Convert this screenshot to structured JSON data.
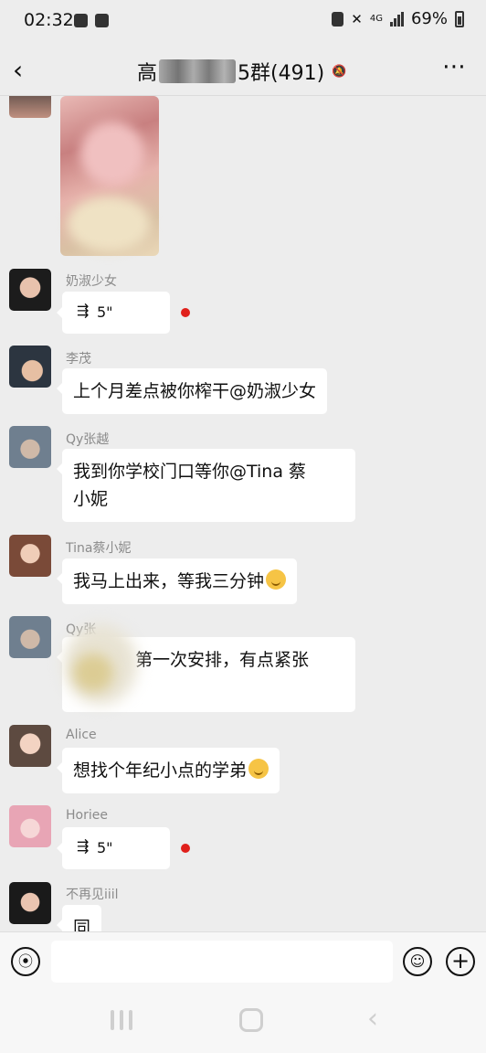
{
  "status_bar": {
    "time": "02:32",
    "network": "4G",
    "battery": "69%"
  },
  "header": {
    "back_icon": "chevron-left-icon",
    "title_start": "高",
    "title_end": "5群(491)",
    "mute_icon": "bell-slash-icon",
    "more_icon": "more-dots-icon"
  },
  "messages": [
    {
      "type": "image",
      "sender": ""
    },
    {
      "type": "voice",
      "sender": "奶淑少女",
      "duration": "5\"",
      "unread": true
    },
    {
      "type": "text",
      "sender": "李茂",
      "text": "上个月差点被你榨干@奶淑少女"
    },
    {
      "type": "text",
      "sender": "Qy张越",
      "line1": "我到你学校门口等你@Tina 蔡",
      "line2": "小妮"
    },
    {
      "type": "text",
      "sender": "Tina蔡小妮",
      "text": "我马上出来，等我三分钟",
      "emoji": "grin-emoji"
    },
    {
      "type": "text",
      "sender": "Qy张",
      "text": "第一次安排，有点紧张"
    },
    {
      "type": "text",
      "sender": "Alice",
      "text": "想找个年纪小点的学弟",
      "emoji": "smile-emoji"
    },
    {
      "type": "voice",
      "sender": "Horiee",
      "duration": "5\"",
      "unread": true
    },
    {
      "type": "text",
      "sender": "不再见iiil",
      "text": "同"
    }
  ],
  "input_bar": {
    "value": "",
    "voice_icon": "voice-icon",
    "emoji_icon": "emoji-icon",
    "plus_icon": "plus-icon"
  },
  "colors": {
    "background": "#ededed",
    "bubble": "#ffffff",
    "unread_dot": "#e0201b",
    "nickname": "#8b8b8b"
  }
}
